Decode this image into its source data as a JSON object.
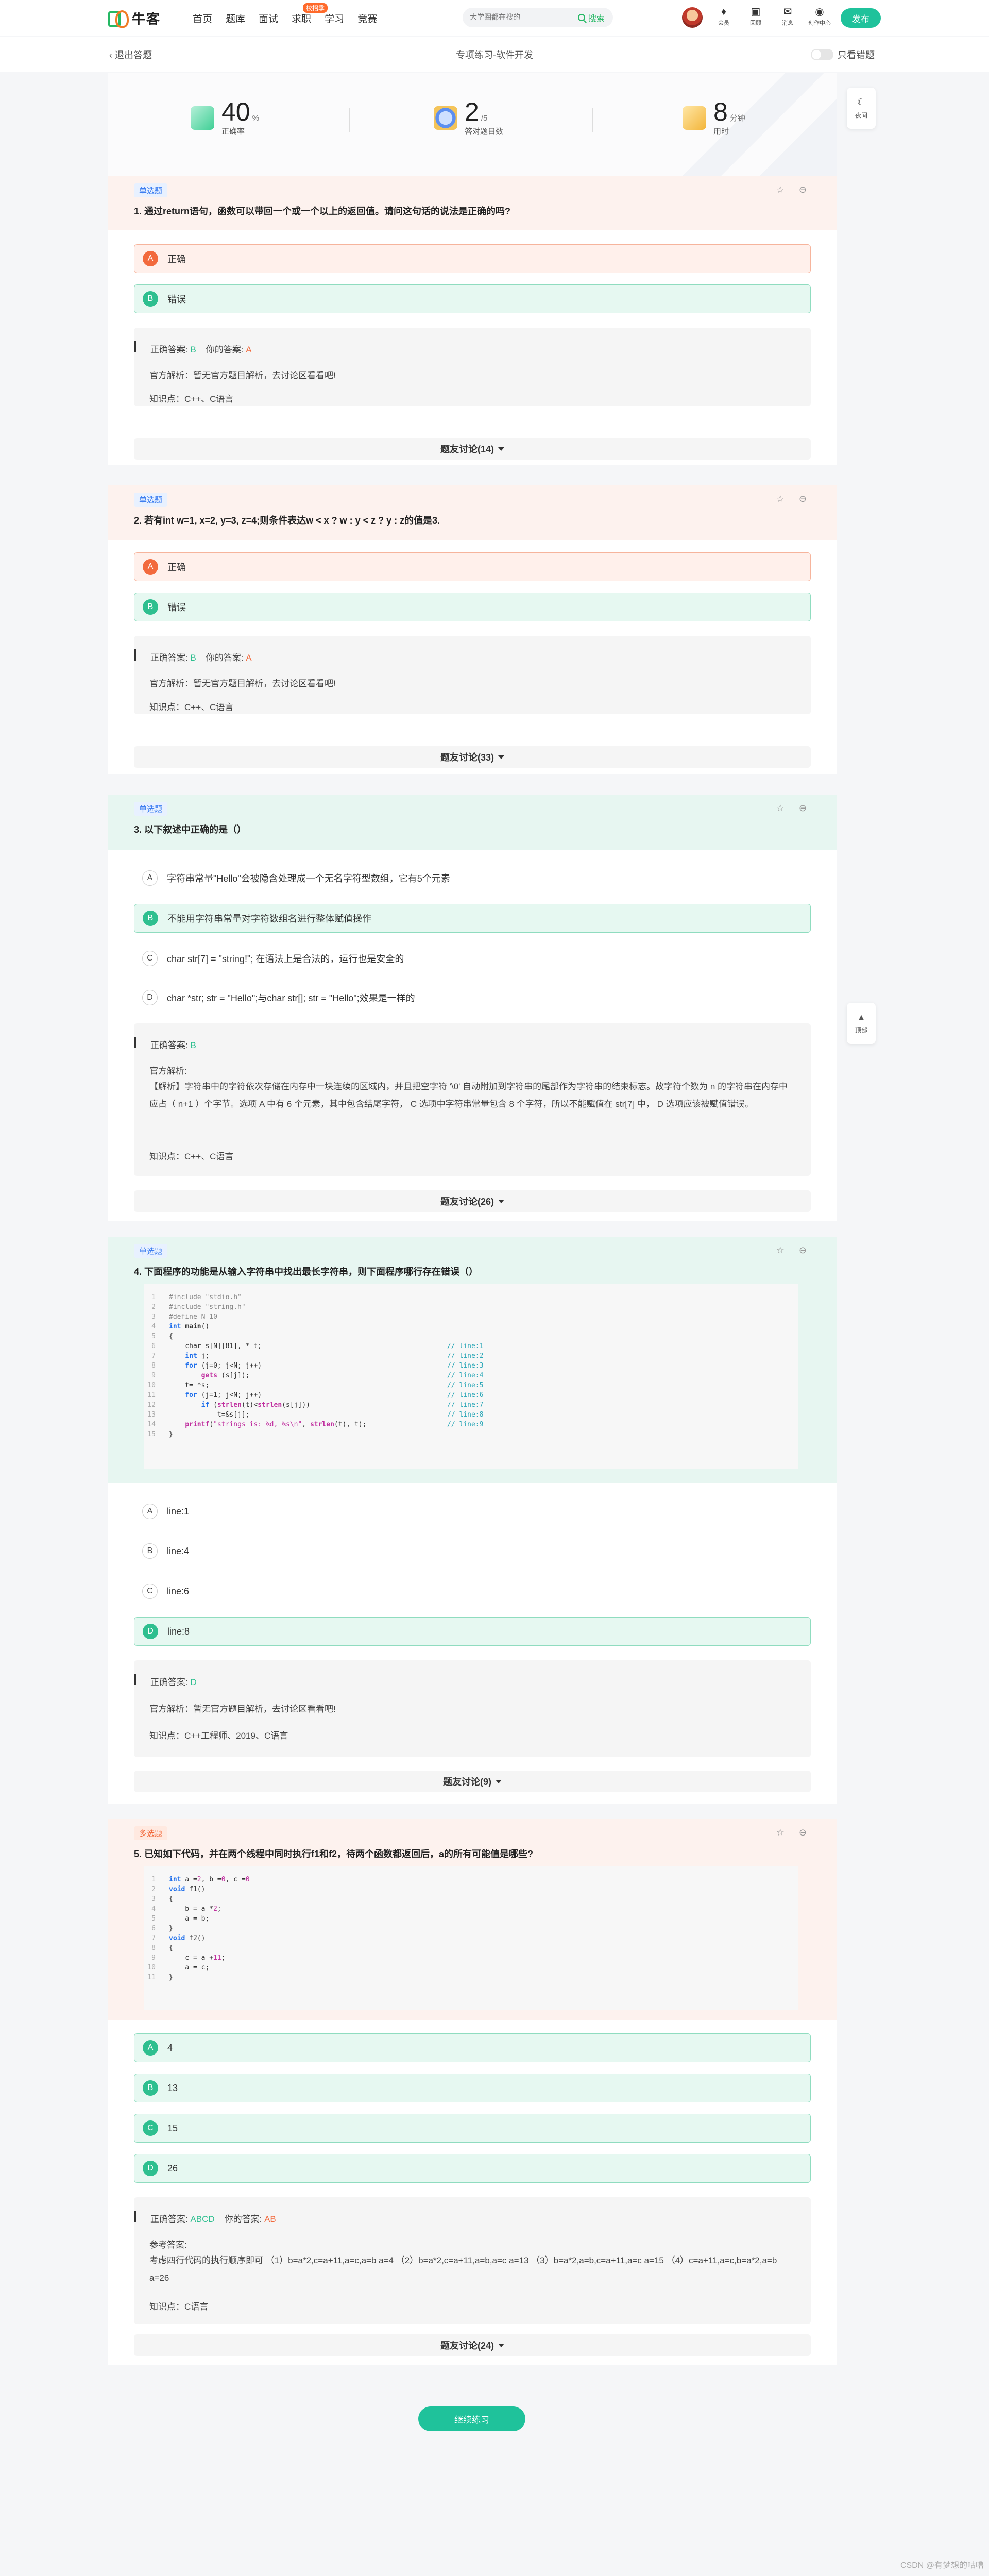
{
  "header": {
    "logo": "牛客",
    "nav": [
      "首页",
      "题库",
      "面试",
      "求职",
      "学习",
      "竞赛"
    ],
    "nav_badge": "校招季",
    "search_placeholder": "大学圈都在搜的",
    "search_button": "搜索",
    "icons": [
      {
        "label": "会员",
        "icon": "diamond-icon"
      },
      {
        "label": "回顾",
        "icon": "book-icon"
      },
      {
        "label": "消息",
        "icon": "mail-icon"
      },
      {
        "label": "创作中心",
        "icon": "location-icon"
      }
    ],
    "publish": "发布"
  },
  "subheader": {
    "back": "退出答题",
    "title": "专项练习-软件开发",
    "toggle_label": "只看错题"
  },
  "stats": {
    "accuracy": {
      "value": "40",
      "unit": "%",
      "label": "正确率"
    },
    "answered": {
      "value": "2",
      "unit": "/5",
      "label": "答对题目数"
    },
    "time": {
      "value": "8",
      "unit": "分钟",
      "label": "用时"
    }
  },
  "side": {
    "theme_label": "夜间",
    "top_label": "顶部"
  },
  "questions": [
    {
      "type": "单选题",
      "title": "1. 通过return语句，函数可以带回一个或一个以上的返回值。请问这句话的说法是正确的吗?",
      "options": [
        {
          "letter": "A",
          "text": "正确"
        },
        {
          "letter": "B",
          "text": "错误"
        }
      ],
      "answer_label": "正确答案:",
      "correct": "B",
      "yours_label": "你的答案:",
      "yours": "A",
      "analysis": "官方解析：暂无官方题目解析，去讨论区看看吧!",
      "knowledge": "知识点：C++、C语言",
      "discussion": "题友讨论(14)"
    },
    {
      "type": "单选题",
      "title": "2. 若有int w=1, x=2, y=3, z=4;则条件表达w < x ? w : y < z ? y : z的值是3.",
      "options": [
        {
          "letter": "A",
          "text": "正确"
        },
        {
          "letter": "B",
          "text": "错误"
        }
      ],
      "answer_label": "正确答案:",
      "correct": "B",
      "yours_label": "你的答案:",
      "yours": "A",
      "analysis": "官方解析：暂无官方题目解析，去讨论区看看吧!",
      "knowledge": "知识点：C++、C语言",
      "discussion": "题友讨论(33)"
    },
    {
      "type": "单选题",
      "title": "3. 以下叙述中正确的是（）",
      "options": [
        {
          "letter": "A",
          "text": "字符串常量\"Hello\"会被隐含处理成一个无名字符型数组，它有5个元素"
        },
        {
          "letter": "B",
          "text": "不能用字符串常量对字符数组名进行整体赋值操作"
        },
        {
          "letter": "C",
          "text": "char str[7] = \"string!\"; 在语法上是合法的，运行也是安全的"
        },
        {
          "letter": "D",
          "text": "char *str; str = \"Hello\";与char str[]; str = \"Hello\";效果是一样的"
        }
      ],
      "answer_label": "正确答案:",
      "correct": "B",
      "analysis_title": "官方解析:",
      "analysis_body": "【解析】字符串中的字符依次存储在内存中一块连续的区域内，并且把空字符 '\\0' 自动附加到字符串的尾部作为字符串的结束标志。故字符个数为 n 的字符串在内存中应占（ n+1 ）个字节。选项 A 中有 6 个元素，其中包含结尾字符， C 选项中字符串常量包含 8 个字符，所以不能赋值在 str[7] 中， D 选项应该被赋值错误。",
      "knowledge": "知识点：C++、C语言",
      "discussion": "题友讨论(26)"
    },
    {
      "type": "单选题",
      "title": "4. 下面程序的功能是从输入字符串中找出最长字符串，则下面程序哪行存在错误（）",
      "options": [
        {
          "letter": "A",
          "text": "line:1"
        },
        {
          "letter": "B",
          "text": "line:4"
        },
        {
          "letter": "C",
          "text": "line:6"
        },
        {
          "letter": "D",
          "text": "line:8"
        }
      ],
      "answer_label": "正确答案:",
      "correct": "D",
      "analysis": "官方解析：暂无官方题目解析，去讨论区看看吧!",
      "knowledge": "知识点：C++工程师、2019、C语言",
      "discussion": "题友讨论(9)"
    },
    {
      "type": "多选题",
      "title": "5. 已知如下代码，并在两个线程中同时执行f1和f2，待两个函数都返回后，a的所有可能值是哪些?",
      "options": [
        {
          "letter": "A",
          "text": "4"
        },
        {
          "letter": "B",
          "text": "13"
        },
        {
          "letter": "C",
          "text": "15"
        },
        {
          "letter": "D",
          "text": "26"
        }
      ],
      "answer_label": "正确答案:",
      "correct": "ABCD",
      "yours_label": "你的答案:",
      "yours": "AB",
      "analysis_title": "参考答案:",
      "analysis_body": "考虑四行代码的执行顺序即可 （1）b=a*2,c=a+11,a=c,a=b a=4 （2）b=a*2,c=a+11,a=b,a=c a=13 （3）b=a*2,a=b,c=a+11,a=c a=15 （4）c=a+11,a=c,b=a*2,a=b a=26",
      "knowledge": "知识点：C语言",
      "discussion": "题友讨论(24)"
    }
  ],
  "next_button": "继续练习",
  "watermark": "CSDN @有梦想的咕噜"
}
